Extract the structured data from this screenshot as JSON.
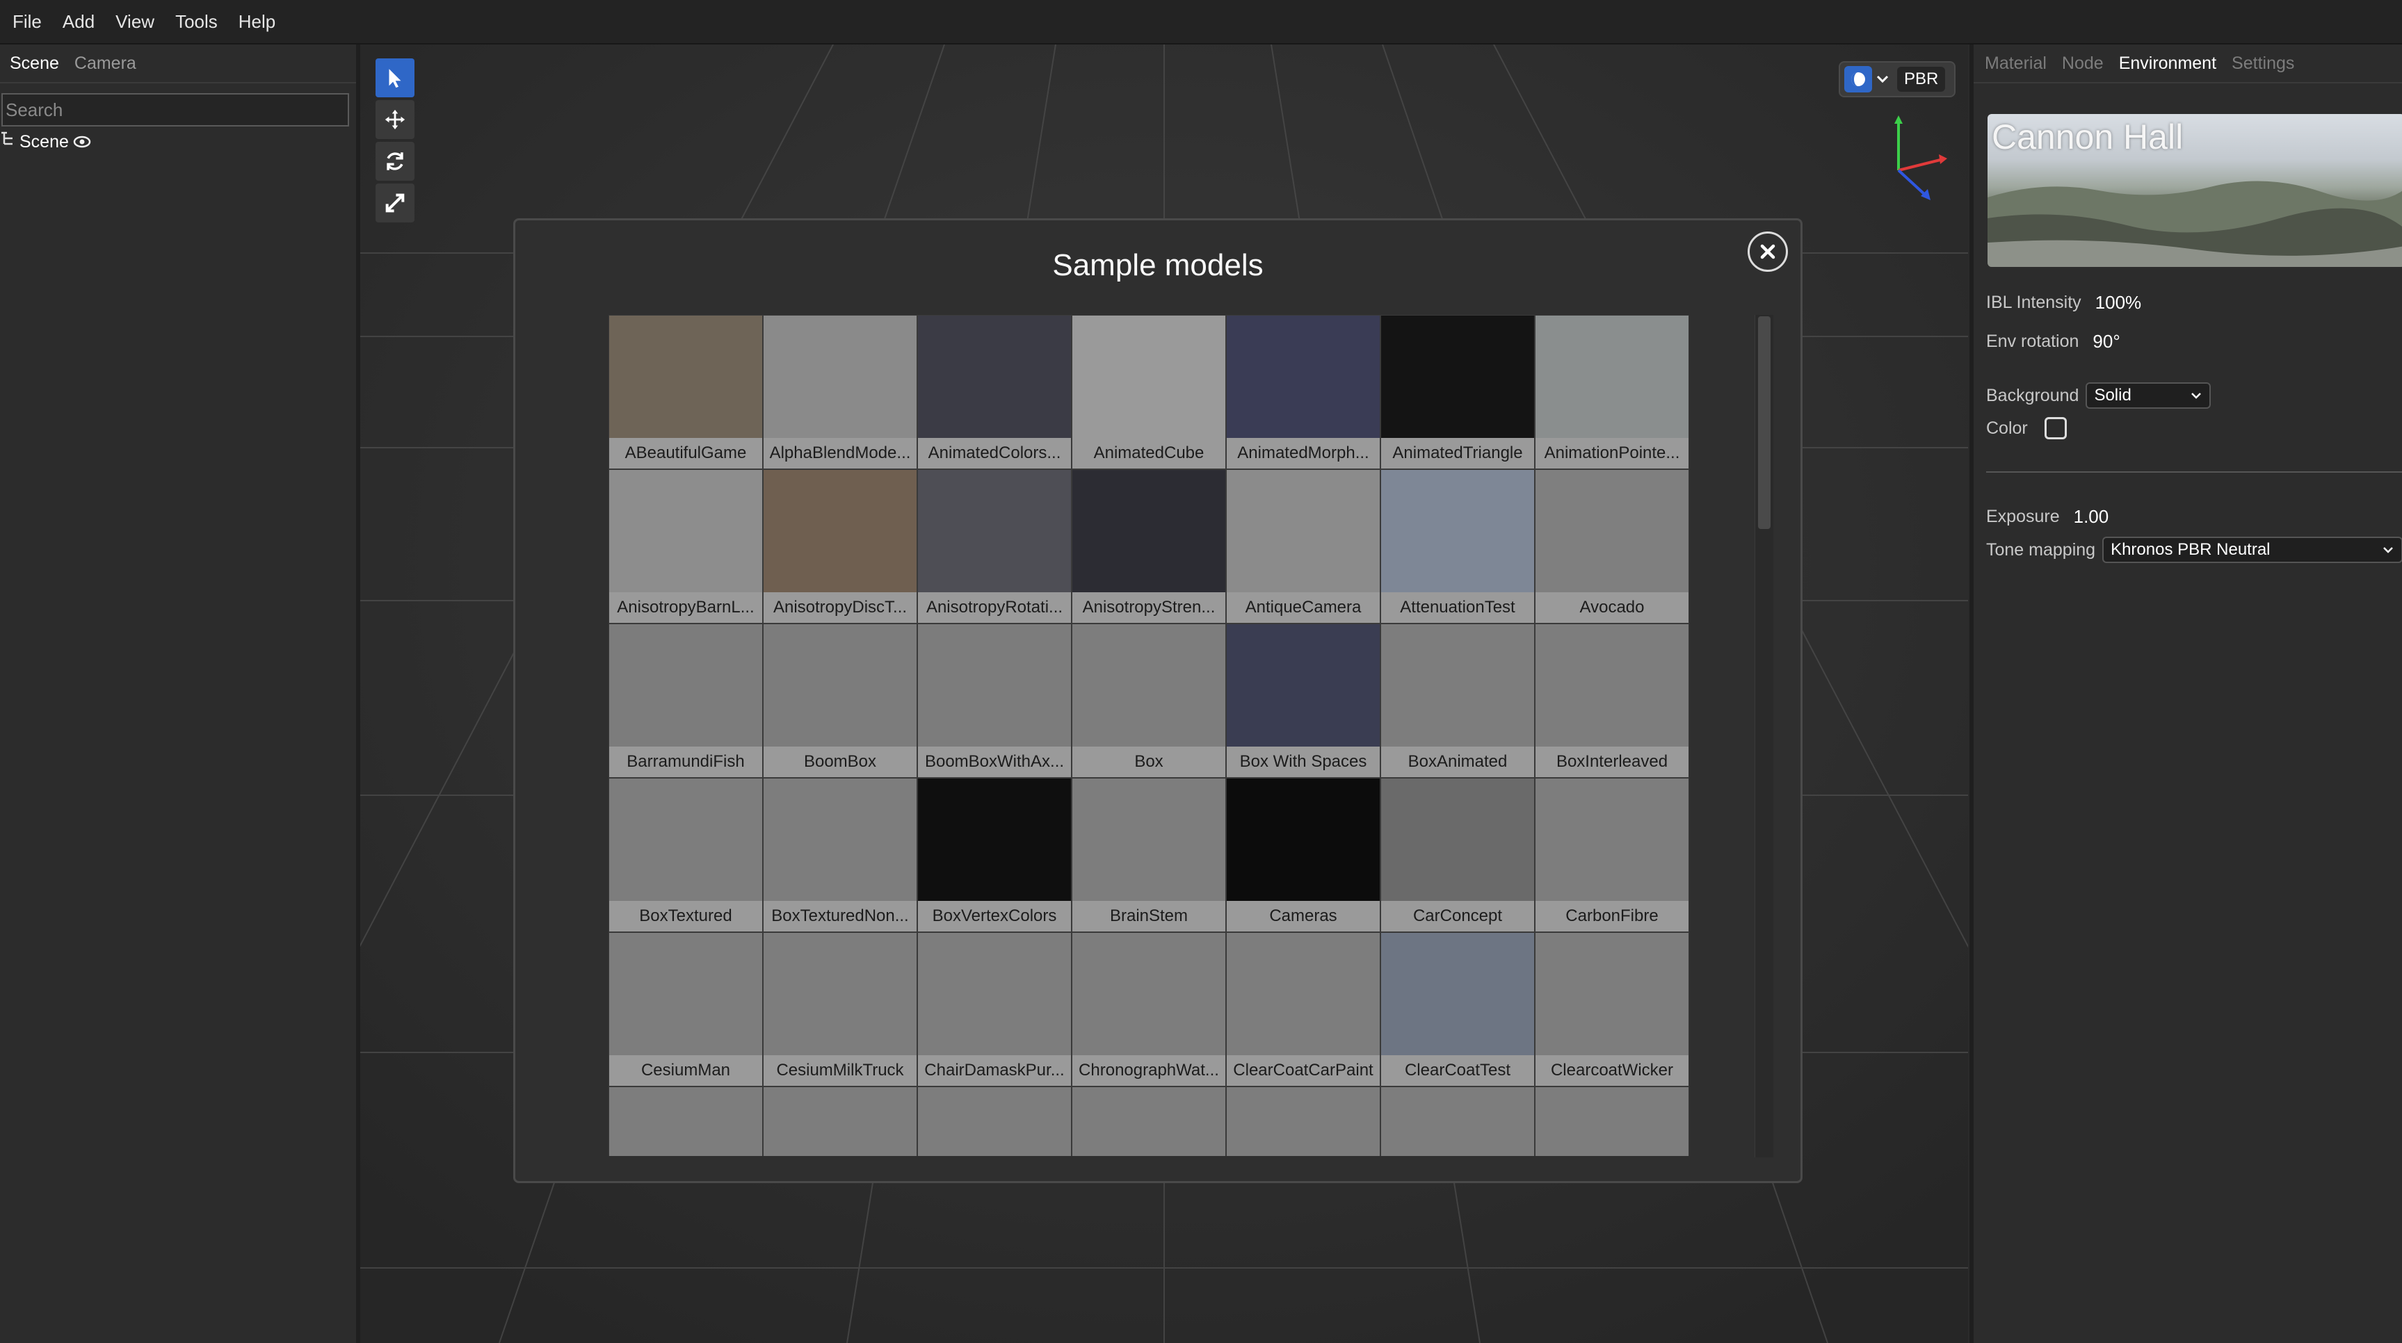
{
  "menu": [
    "File",
    "Add",
    "View",
    "Tools",
    "Help"
  ],
  "left_panel": {
    "tabs": [
      "Scene",
      "Camera"
    ],
    "active_tab": "Scene",
    "search_placeholder": "Search",
    "scene_root": "Scene"
  },
  "viewport": {
    "shading_mode": "PBR"
  },
  "right_panel": {
    "tabs": [
      "Material",
      "Node",
      "Environment",
      "Settings"
    ],
    "active_tab": "Environment",
    "env_name": "Cannon Hall",
    "ibl_intensity_label": "IBL Intensity",
    "ibl_intensity_value": "100%",
    "env_rotation_label": "Env rotation",
    "env_rotation_value": "90°",
    "background_label": "Background",
    "background_value": "Solid",
    "color_label": "Color",
    "exposure_label": "Exposure",
    "exposure_value": "1.00",
    "tone_mapping_label": "Tone mapping",
    "tone_mapping_value": "Khronos PBR Neutral"
  },
  "modal": {
    "title": "Sample models",
    "models": [
      "ABeautifulGame",
      "AlphaBlendMode...",
      "AnimatedColors...",
      "AnimatedCube",
      "AnimatedMorph...",
      "AnimatedTriangle",
      "AnimationPointe...",
      "AnisotropyBarnL...",
      "AnisotropyDiscT...",
      "AnisotropyRotati...",
      "AnisotropyStren...",
      "AntiqueCamera",
      "AttenuationTest",
      "Avocado",
      "BarramundiFish",
      "BoomBox",
      "BoomBoxWithAx...",
      "Box",
      "Box With Spaces",
      "BoxAnimated",
      "BoxInterleaved",
      "BoxTextured",
      "BoxTexturedNon...",
      "BoxVertexColors",
      "BrainStem",
      "Cameras",
      "CarConcept",
      "CarbonFibre",
      "CesiumMan",
      "CesiumMilkTruck",
      "ChairDamaskPur...",
      "ChronographWat...",
      "ClearCoatCarPaint",
      "ClearCoatTest",
      "ClearcoatWicker",
      "",
      "",
      "",
      "",
      "",
      "",
      ""
    ],
    "thumb_colors": [
      "#6e6457",
      "#8a8a8a",
      "#3b3b45",
      "#9a9a9a",
      "#3a3c55",
      "#141414",
      "#8a8e8e",
      "#8d8d8d",
      "#6f5f50",
      "#4e4e55",
      "#2c2c33",
      "#8b8b8b",
      "#7e8796",
      "#7f7f7f",
      "#7c7c7c",
      "#7c7c7c",
      "#7c7c7c",
      "#7d7d7d",
      "#3a3d52",
      "#7d7d7d",
      "#7d7d7d",
      "#7d7d7d",
      "#7d7d7d",
      "#0f0f0f",
      "#7d7d7d",
      "#0c0c0c",
      "#6a6a6a",
      "#7d7d7d",
      "#7d7d7d",
      "#7d7d7d",
      "#7d7d7d",
      "#7d7d7d",
      "#7d7d7d",
      "#6d7583",
      "#7d7d7d",
      "#7d7d7d",
      "#7d7d7d",
      "#7d7d7d",
      "#7d7d7d",
      "#7d7d7d",
      "#7d7d7d",
      "#7d7d7d"
    ]
  },
  "colors": {
    "accent": "#2f67c7",
    "background": "#2b2b2b",
    "panel": "#2c2c2c"
  }
}
